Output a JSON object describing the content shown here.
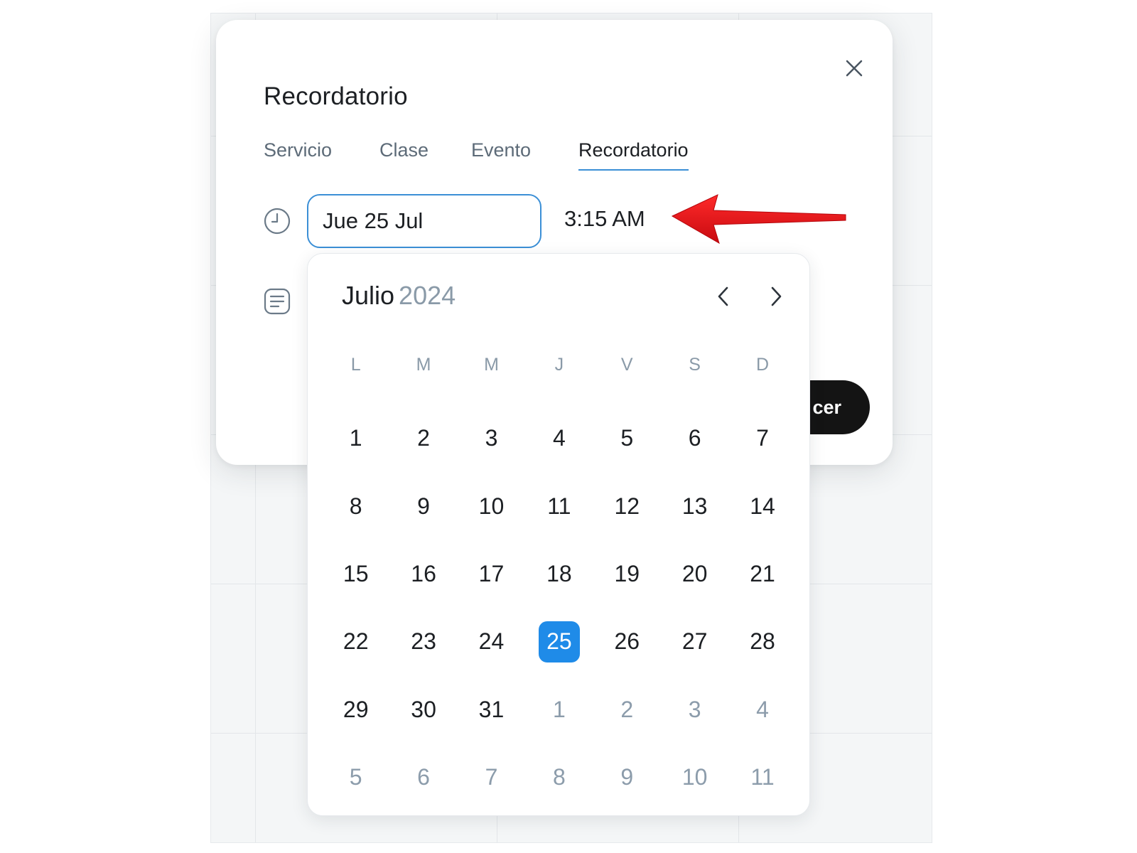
{
  "modal": {
    "title": "Recordatorio",
    "close_icon": "close-icon",
    "tabs": [
      {
        "label": "Servicio",
        "active": false
      },
      {
        "label": "Clase",
        "active": false
      },
      {
        "label": "Evento",
        "active": false
      },
      {
        "label": "Recordatorio",
        "active": true
      }
    ],
    "date_value": "Jue 25 Jul",
    "time_value": "3:15 AM",
    "submit_label_visible": "cer"
  },
  "calendar": {
    "month": "Julio",
    "year": "2024",
    "weekdays": [
      "L",
      "M",
      "M",
      "J",
      "V",
      "S",
      "D"
    ],
    "days": [
      {
        "d": "1",
        "muted": false
      },
      {
        "d": "2",
        "muted": false
      },
      {
        "d": "3",
        "muted": false
      },
      {
        "d": "4",
        "muted": false
      },
      {
        "d": "5",
        "muted": false
      },
      {
        "d": "6",
        "muted": false
      },
      {
        "d": "7",
        "muted": false
      },
      {
        "d": "8",
        "muted": false
      },
      {
        "d": "9",
        "muted": false
      },
      {
        "d": "10",
        "muted": false
      },
      {
        "d": "11",
        "muted": false
      },
      {
        "d": "12",
        "muted": false
      },
      {
        "d": "13",
        "muted": false
      },
      {
        "d": "14",
        "muted": false
      },
      {
        "d": "15",
        "muted": false
      },
      {
        "d": "16",
        "muted": false
      },
      {
        "d": "17",
        "muted": false
      },
      {
        "d": "18",
        "muted": false
      },
      {
        "d": "19",
        "muted": false
      },
      {
        "d": "20",
        "muted": false
      },
      {
        "d": "21",
        "muted": false
      },
      {
        "d": "22",
        "muted": false
      },
      {
        "d": "23",
        "muted": false
      },
      {
        "d": "24",
        "muted": false
      },
      {
        "d": "25",
        "muted": false,
        "selected": true
      },
      {
        "d": "26",
        "muted": false
      },
      {
        "d": "27",
        "muted": false
      },
      {
        "d": "28",
        "muted": false
      },
      {
        "d": "29",
        "muted": false
      },
      {
        "d": "30",
        "muted": false
      },
      {
        "d": "31",
        "muted": false
      },
      {
        "d": "1",
        "muted": true
      },
      {
        "d": "2",
        "muted": true
      },
      {
        "d": "3",
        "muted": true
      },
      {
        "d": "4",
        "muted": true
      },
      {
        "d": "5",
        "muted": true
      },
      {
        "d": "6",
        "muted": true
      },
      {
        "d": "7",
        "muted": true
      },
      {
        "d": "8",
        "muted": true
      },
      {
        "d": "9",
        "muted": true
      },
      {
        "d": "10",
        "muted": true
      },
      {
        "d": "11",
        "muted": true
      }
    ],
    "selected_day": "25",
    "prev_icon": "chevron-left-icon",
    "next_icon": "chevron-right-icon"
  },
  "colors": {
    "accent": "#1f8be8",
    "input_border": "#3b8fd6",
    "annotation_arrow": "#e8141c",
    "submit_bg": "#141414"
  },
  "icons": {
    "time_row": "clock-icon",
    "notes_row": "notes-icon",
    "annotation": "red-arrow-icon"
  }
}
